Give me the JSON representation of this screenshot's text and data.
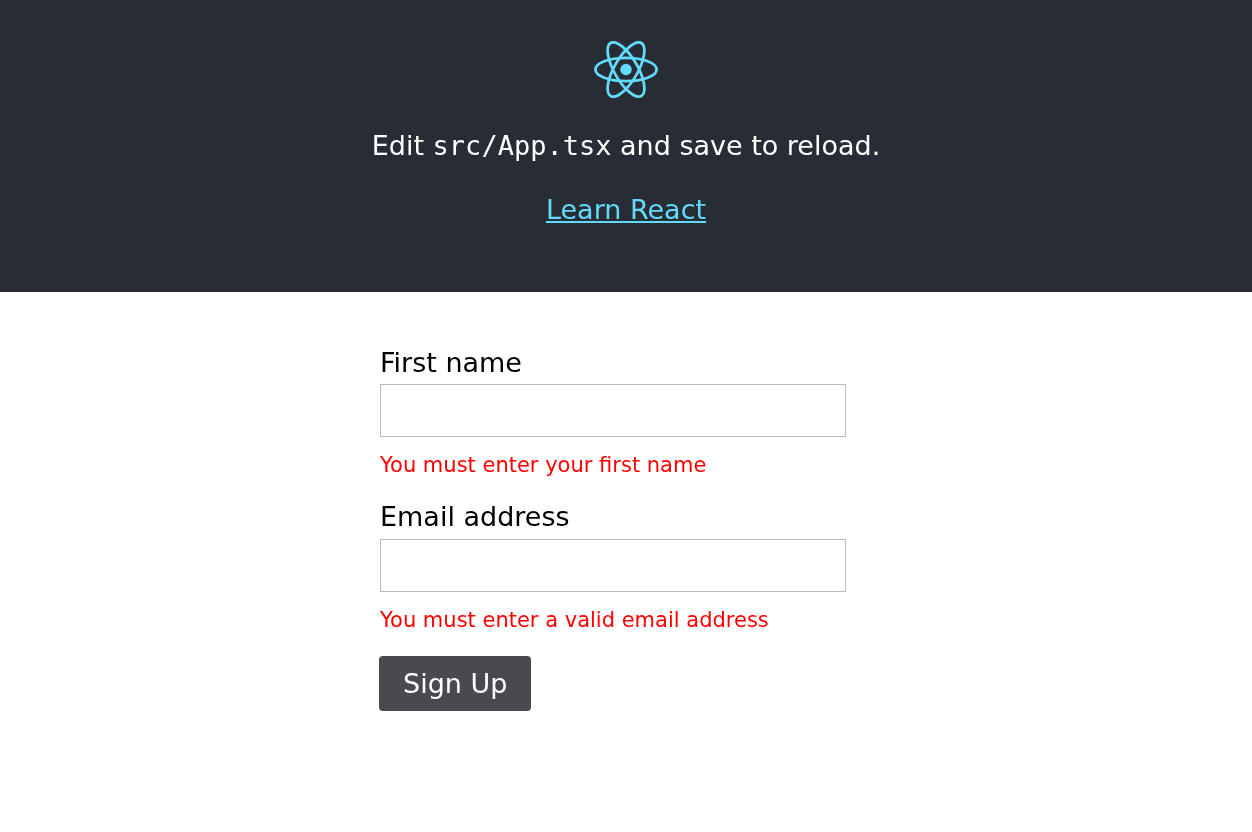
{
  "header": {
    "instruction": {
      "before": "Edit",
      "code": "src/App.tsx",
      "after": "and save to reload."
    },
    "link": "Learn React"
  },
  "form": {
    "fields": [
      {
        "label": "First name",
        "error": "You must enter your first name"
      },
      {
        "label": "Email address",
        "error": "You must enter a valid email address"
      }
    ],
    "submit": "Sign Up"
  }
}
